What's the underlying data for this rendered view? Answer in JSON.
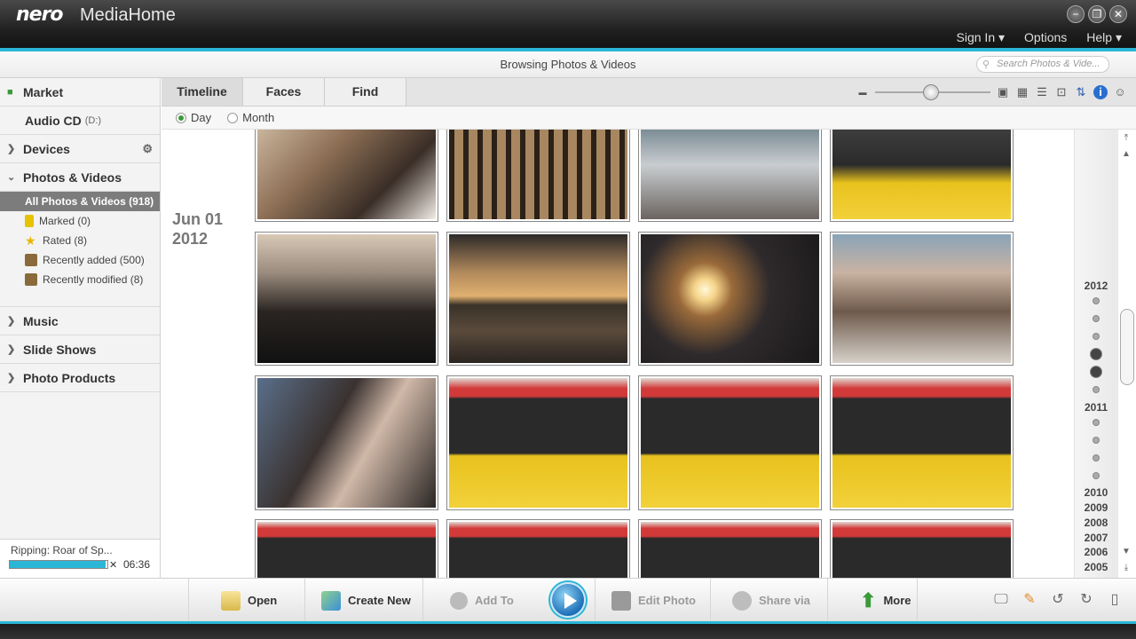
{
  "app": {
    "logo": "nero",
    "name": "MediaHome"
  },
  "window_buttons": [
    "−",
    "❐",
    "✕"
  ],
  "top_menu": [
    {
      "label": "Sign In ▾"
    },
    {
      "label": "Options"
    },
    {
      "label": "Help ▾"
    }
  ],
  "browse_title": "Browsing Photos & Videos",
  "search": {
    "placeholder": "Search Photos & Vide..."
  },
  "sidebar": {
    "market": "Market",
    "audio_cd": {
      "label": "Audio CD",
      "drive": "(D:)"
    },
    "devices": "Devices",
    "photos_videos": "Photos & Videos",
    "all_items": "All Photos & Videos (918)",
    "sub_items": [
      {
        "label": "Marked (0)",
        "icon": "marked-icon"
      },
      {
        "label": "Rated (8)",
        "icon": "star-icon"
      },
      {
        "label": "Recently added (500)",
        "icon": "recently-added-icon"
      },
      {
        "label": "Recently modified (8)",
        "icon": "recently-modified-icon"
      }
    ],
    "music": "Music",
    "slide_shows": "Slide Shows",
    "photo_products": "Photo Products"
  },
  "ripping": {
    "label": "Ripping: Roar of Sp...",
    "progress": 0.98,
    "time": "06:36"
  },
  "tabs": [
    {
      "label": "Timeline",
      "active": true
    },
    {
      "label": "Faces",
      "active": false
    },
    {
      "label": "Find",
      "active": false
    }
  ],
  "view_modes": [
    {
      "label": "Day",
      "selected": true
    },
    {
      "label": "Month",
      "selected": false
    }
  ],
  "date_group": {
    "month_day": "Jun 01",
    "year": "2012"
  },
  "timeline": {
    "years": [
      "2012",
      "2011",
      "2010",
      "2009",
      "2008",
      "2007",
      "2006",
      "2005"
    ]
  },
  "bottom_bar": {
    "open": "Open",
    "create_new": "Create New",
    "add_to": "Add To",
    "edit_photo": "Edit Photo",
    "share_via": "Share via",
    "more": "More"
  },
  "colors": {
    "accent": "#2bb6d6",
    "selected_bg": "#7c7c7c",
    "play": "#1e70b8"
  }
}
